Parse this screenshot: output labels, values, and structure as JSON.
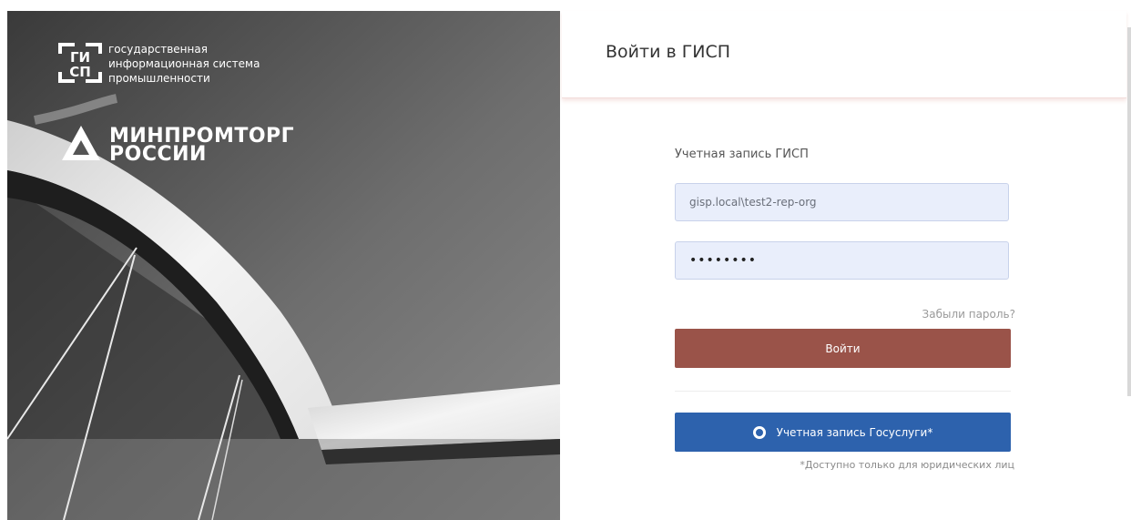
{
  "brand": {
    "gisp_lines": [
      "государственная",
      "информационная система",
      "промышленности"
    ],
    "ministry_lines": [
      "МИНПРОМТОРГ",
      "РОССИИ"
    ]
  },
  "login": {
    "title": "Войти в ГИСП",
    "account_label": "Учетная запись ГИСП",
    "login_value": "gisp.local\\test2-rep-org",
    "password_value": "••••••••",
    "forgot_link": "Забыли пароль?",
    "submit_label": "Войти",
    "gosuslugi_label": "Учетная запись Госуслуги*",
    "gosuslugi_note": "*Доступно только для юридических лиц"
  },
  "colors": {
    "submit_bg": "#9a5349",
    "gosuslugi_bg": "#2d62ad",
    "input_bg": "#e9eefb"
  }
}
